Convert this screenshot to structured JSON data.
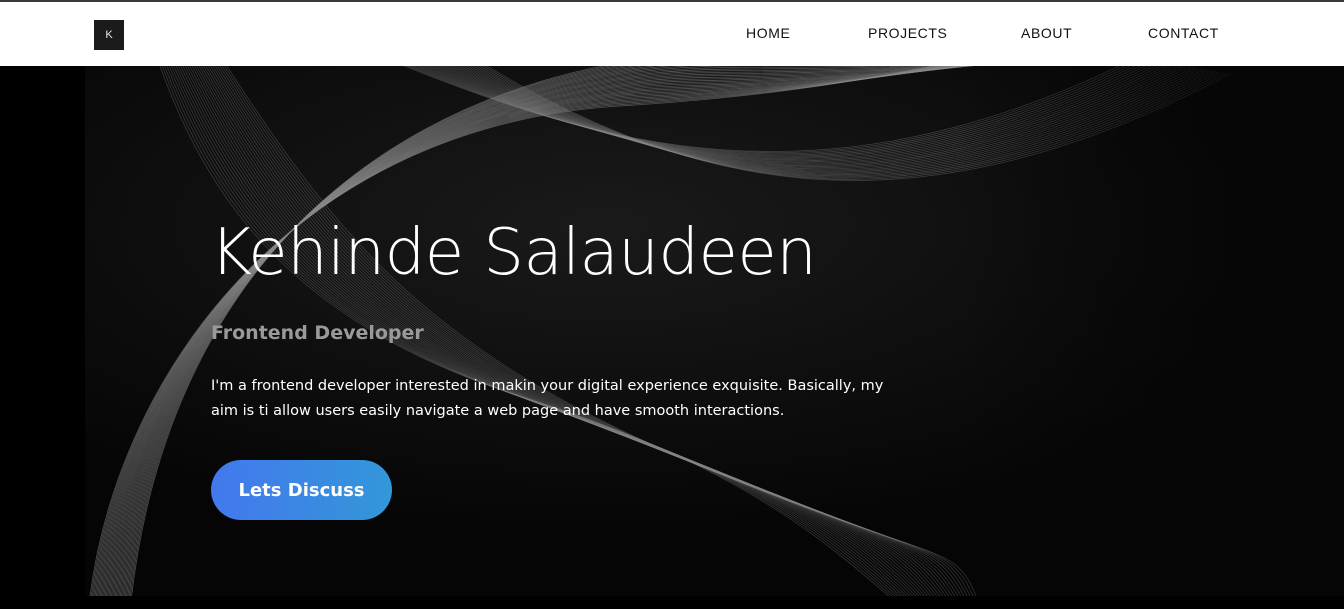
{
  "header": {
    "logo_letter": "K",
    "nav": [
      "HOME",
      "PROJECTS",
      "ABOUT",
      "CONTACT"
    ]
  },
  "hero": {
    "name": "Kehinde Salaudeen",
    "role": "Frontend Developer",
    "description": "I'm a frontend developer interested in makin your digital experience exquisite. Basically, my aim is ti allow users easily navigate a web page and have smooth interactions.",
    "cta_label": "Lets Discuss"
  },
  "colors": {
    "header_bg": "#ffffff",
    "hero_bg": "#050505",
    "cta_gradient_start": "#4378ee",
    "cta_gradient_end": "#3397d9"
  }
}
